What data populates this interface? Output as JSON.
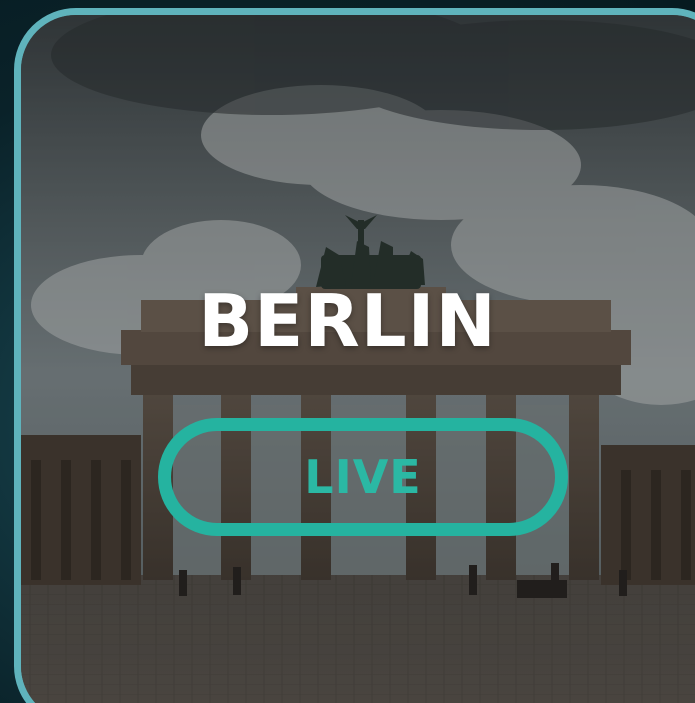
{
  "city": {
    "name": "BERLIN"
  },
  "live_button": {
    "label": "LIVE"
  },
  "colors": {
    "accent": "#25b3a0",
    "card_border": "#5fb3bc",
    "title_text": "#ffffff"
  },
  "background_image": {
    "subject": "brandenburg-gate-photo"
  }
}
